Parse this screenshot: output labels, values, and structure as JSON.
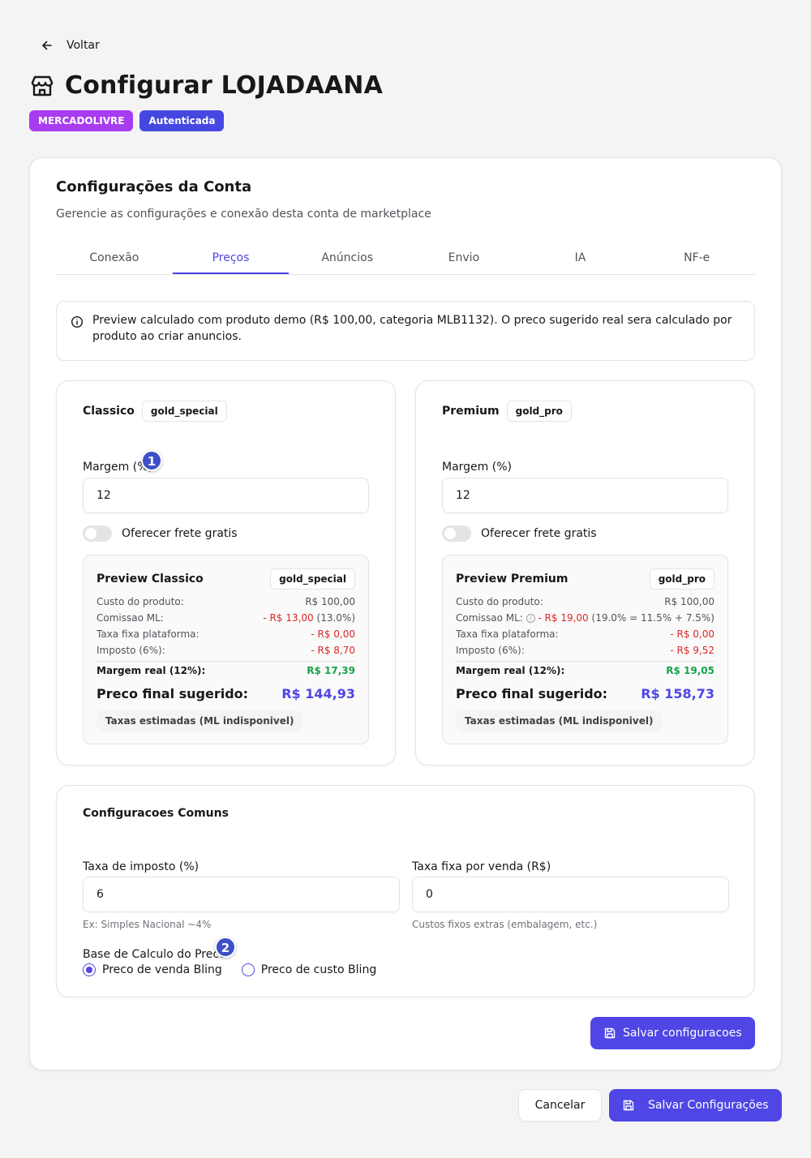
{
  "nav": {
    "back_label": "Voltar"
  },
  "header": {
    "title": "Configurar LOJADAANA",
    "badges": [
      "MERCADOLIVRE",
      "Autenticada"
    ]
  },
  "card": {
    "title": "Configurações da Conta",
    "subtitle": "Gerencie as configurações e conexão desta conta de marketplace"
  },
  "tabs": [
    {
      "label": "Conexão",
      "active": false
    },
    {
      "label": "Preços",
      "active": true
    },
    {
      "label": "Anúncios",
      "active": false
    },
    {
      "label": "Envio",
      "active": false
    },
    {
      "label": "IA",
      "active": false
    },
    {
      "label": "NF-e",
      "active": false
    }
  ],
  "info_text": "Preview calculado com produto demo (R$ 100,00, categoria MLB1132). O preco sugerido real sera calculado por produto ao criar anuncios.",
  "plans": [
    {
      "name": "Classico",
      "tag": "gold_special",
      "margin_label": "Margem (%)",
      "margin_value": "12",
      "free_shipping_label": "Oferecer frete gratis",
      "free_shipping": false,
      "preview": {
        "title": "Preview Classico",
        "tag": "gold_special",
        "rows": [
          {
            "label": "Custo do produto:",
            "value": "R$ 100,00",
            "negative": false
          },
          {
            "label": "Comissao ML:",
            "value": "- R$ 13,00",
            "extra": "(13.0%)",
            "negative": true
          },
          {
            "label": "Taxa fixa plataforma:",
            "value": "- R$ 0,00",
            "negative": true
          },
          {
            "label": "Imposto (6%):",
            "value": "- R$ 8,70",
            "negative": true
          }
        ],
        "margin_label": "Margem real (12%):",
        "margin_value": "R$ 17,39",
        "final_label": "Preco final sugerido:",
        "final_value": "R$ 144,93",
        "chip": "Taxas estimadas (ML indisponivel)"
      }
    },
    {
      "name": "Premium",
      "tag": "gold_pro",
      "margin_label": "Margem (%)",
      "margin_value": "12",
      "free_shipping_label": "Oferecer frete gratis",
      "free_shipping": false,
      "preview": {
        "title": "Preview Premium",
        "tag": "gold_pro",
        "rows": [
          {
            "label": "Custo do produto:",
            "value": "R$ 100,00",
            "negative": false
          },
          {
            "label": "Comissao ML:",
            "value": "- R$ 19,00",
            "extra": "(19.0% = 11.5% + 7.5%)",
            "negative": true
          },
          {
            "label": "Taxa fixa plataforma:",
            "value": "- R$ 0,00",
            "negative": true
          },
          {
            "label": "Imposto (6%):",
            "value": "- R$ 9,52",
            "negative": true
          }
        ],
        "margin_label": "Margem real (12%):",
        "margin_value": "R$ 19,05",
        "final_label": "Preco final sugerido:",
        "final_value": "R$ 158,73",
        "chip": "Taxas estimadas (ML indisponivel)"
      }
    }
  ],
  "common": {
    "title": "Configuracoes Comuns",
    "tax_label": "Taxa de imposto (%)",
    "tax_value": "6",
    "tax_hint": "Ex: Simples Nacional ~4%",
    "fixed_label": "Taxa fixa por venda (R$)",
    "fixed_value": "0",
    "fixed_hint": "Custos fixos extras (embalagem, etc.)",
    "base_label": "Base de Calculo do Preco",
    "options": [
      {
        "label": "Preco de venda Bling",
        "selected": true
      },
      {
        "label": "Preco de custo Bling",
        "selected": false
      }
    ]
  },
  "steps": [
    "1",
    "2"
  ],
  "buttons": {
    "save_inner": "Salvar configuracoes",
    "cancel": "Cancelar",
    "save_outer": "Salvar Configurações"
  },
  "colors": {
    "accent": "#4f46e5",
    "badge_marketplace": "#a83cf0",
    "badge_auth": "#4548e0",
    "negative": "#dc2626",
    "positive": "#16a34a"
  },
  "icons": {
    "back": "arrow-left-icon",
    "store": "store-icon",
    "info": "info-icon",
    "save": "save-icon"
  }
}
